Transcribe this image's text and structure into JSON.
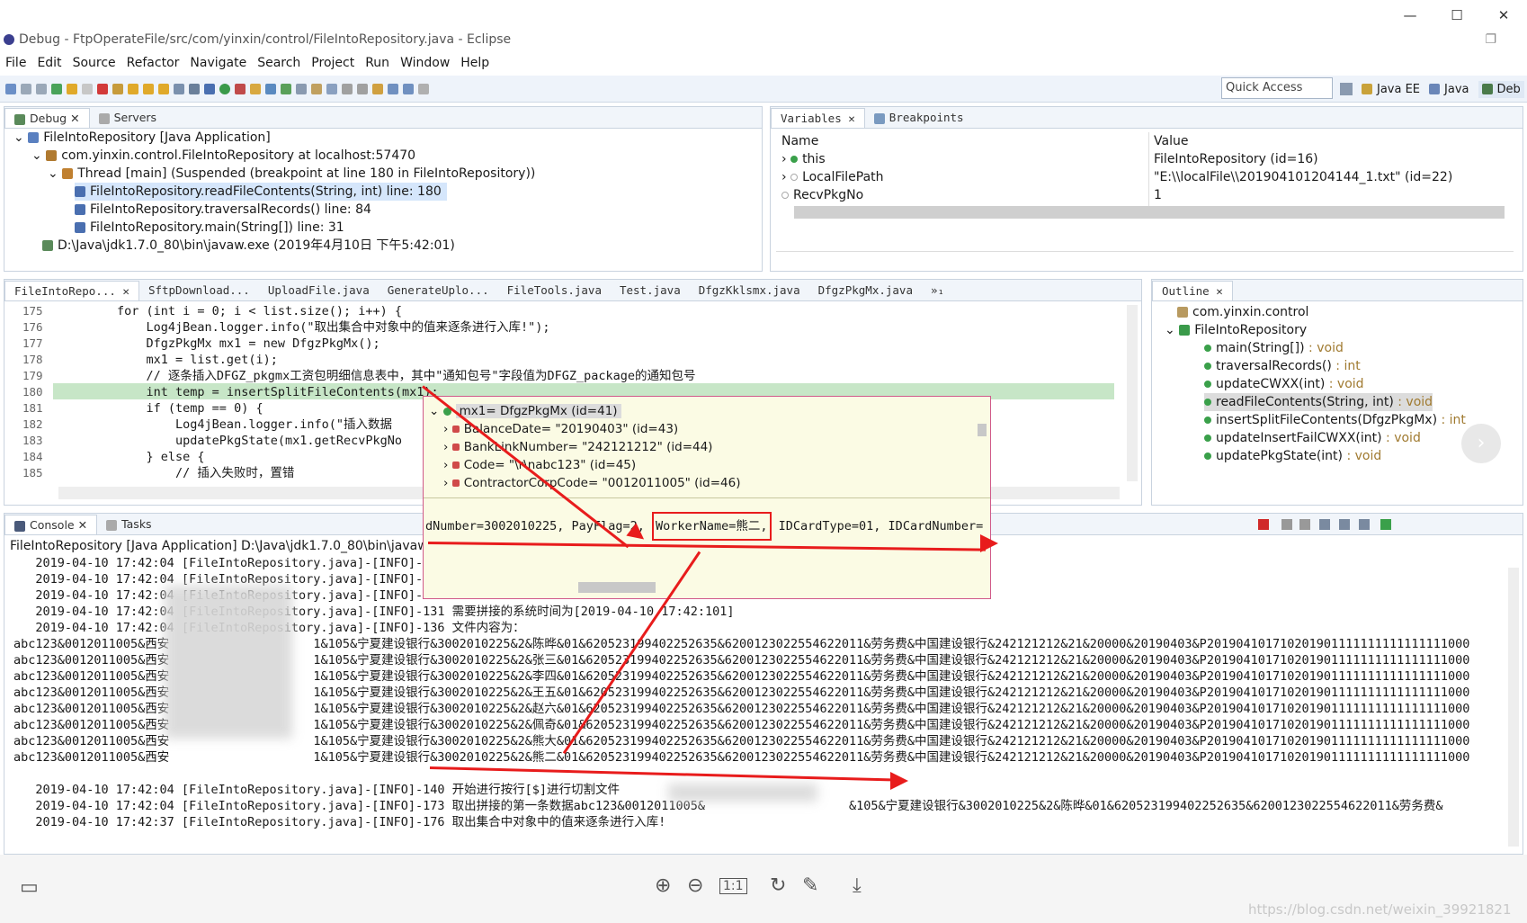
{
  "window": {
    "title": "Debug - FtpOperateFile/src/com/yinxin/control/FileIntoRepository.java - Eclipse",
    "controls": [
      "—",
      "☐",
      "✕"
    ]
  },
  "menu": [
    "File",
    "Edit",
    "Source",
    "Refactor",
    "Navigate",
    "Search",
    "Project",
    "Run",
    "Window",
    "Help"
  ],
  "toolbar": {
    "quick_access": "Quick Access",
    "perspectives": [
      "Java EE",
      "Java",
      "Deb"
    ]
  },
  "debug": {
    "tabs": [
      "Debug",
      "Servers"
    ],
    "tree": [
      "FileIntoRepository [Java Application]",
      "com.yinxin.control.FileIntoRepository at localhost:57470",
      "Thread [main] (Suspended (breakpoint at line 180 in FileIntoRepository))",
      "FileIntoRepository.readFileContents(String, int) line: 180",
      "FileIntoRepository.traversalRecords() line: 84",
      "FileIntoRepository.main(String[]) line: 31",
      "D:\\Java\\jdk1.7.0_80\\bin\\javaw.exe (2019年4月10日 下午5:42:01)"
    ]
  },
  "variables": {
    "tabs": [
      "Variables",
      "Breakpoints"
    ],
    "col_name": "Name",
    "col_value": "Value",
    "rows": [
      {
        "name": "this",
        "value": "FileIntoRepository  (id=16)"
      },
      {
        "name": "LocalFilePath",
        "value": "\"E:\\\\localFile\\\\201904101204144_1.txt\" (id=22)"
      },
      {
        "name": "RecvPkgNo",
        "value": "1"
      }
    ]
  },
  "editor": {
    "tabs": [
      "FileIntoRepo...",
      "SftpDownload...",
      "UploadFile.java",
      "GenerateUplo...",
      "FileTools.java",
      "Test.java",
      "DfgzKklsmx.java",
      "DfgzPkgMx.java",
      "»₁"
    ],
    "lines": [
      "175",
      "176",
      "177",
      "178",
      "179",
      "180",
      "181",
      "182",
      "183",
      "184",
      "185"
    ],
    "code": [
      "        for (int i = 0; i < list.size(); i++) {",
      "            Log4jBean.logger.info(\"取出集合中对象中的值来逐条进行入库!\");",
      "            DfgzPkgMx mx1 = new DfgzPkgMx();",
      "            mx1 = list.get(i);",
      "            // 逐条插入DFGZ_pkgmx工资包明细信息表中，其中\"通知包号\"字段值为DFGZ_package的通知包号",
      "            int temp = insertSplitFileContents(mx1);",
      "            if (temp == 0) {",
      "                Log4jBean.logger.info(\"插入数据",
      "                updatePkgState(mx1.getRecvPkgNo",
      "            } else {",
      "                // 插入失败时，置错"
    ]
  },
  "hover": {
    "items": [
      "mx1= DfgzPkgMx  (id=41)",
      "BalanceDate= \"20190403\" (id=43)",
      "BankLinkNumber= \"242121212\" (id=44)",
      "Code= \"\\r\\nabc123\" (id=45)",
      "ContractorCorpCode= \"0012011005\" (id=46)"
    ],
    "detail_pre": "dNumber=3002010225, PayFlag=2, ",
    "detail_box": "WorkerName=熊二,",
    "detail_post": " IDCardType=01, IDCardNumber="
  },
  "outline": {
    "tab": "Outline",
    "items": [
      {
        "name": "com.yinxin.control",
        "type": ""
      },
      {
        "name": "FileIntoRepository",
        "type": ""
      },
      {
        "name": "main(String[])",
        "type": " : void"
      },
      {
        "name": "traversalRecords()",
        "type": " : int"
      },
      {
        "name": "updateCWXX(int)",
        "type": " : void"
      },
      {
        "name": "readFileContents(String, int)",
        "type": " : void"
      },
      {
        "name": "insertSplitFileContents(DfgzPkgMx)",
        "type": " : int"
      },
      {
        "name": "updateInsertFailCWXX(int)",
        "type": " : void"
      },
      {
        "name": "updatePkgState(int)",
        "type": " : void"
      }
    ]
  },
  "console": {
    "tabs": [
      "Console",
      "Tasks"
    ],
    "header": "FileIntoRepository [Java Application] D:\\Java\\jdk1.7.0_80\\bin\\javaw.exe",
    "lines": [
      "   2019-04-10 17:42:04 [FileIntoRepository.java]-[INFO]-8",
      "   2019-04-10 17:42:04 [FileIntoRepository.java]-[INFO]-1",
      "   2019-04-10 17:42:04 [FileIntoRepository.java]-[INFO]-1",
      "   2019-04-10 17:42:04 [FileIntoRepository.java]-[INFO]-131 需要拼接的系统时间为[2019-04-10 17:42:101]",
      "   2019-04-10 17:42:04 [FileIntoRepository.java]-[INFO]-136 文件内容为：",
      "abc123&0012011005&西安",
      "abc123&0012011005&西安",
      "abc123&0012011005&西安",
      "abc123&0012011005&西安",
      "abc123&0012011005&西安",
      "abc123&0012011005&西安",
      "abc123&0012011005&西安",
      "abc123&0012011005&西安"
    ],
    "records": [
      "1&105&宁夏建设银行&3002010225&2&陈晔&01&620523199402252635&6200123022554622011&劳务费&中国建设银行&242121212&21&20000&20190403&P201904101710201901111111111111111000",
      "1&105&宁夏建设银行&3002010225&2&张三&01&620523199402252635&6200123022554622011&劳务费&中国建设银行&242121212&21&20000&20190403&P201904101710201901111111111111111000",
      "1&105&宁夏建设银行&3002010225&2&李四&01&620523199402252635&6200123022554622011&劳务费&中国建设银行&242121212&21&20000&20190403&P201904101710201901111111111111111000",
      "1&105&宁夏建设银行&3002010225&2&王五&01&620523199402252635&6200123022554622011&劳务费&中国建设银行&242121212&21&20000&20190403&P201904101710201901111111111111111000",
      "1&105&宁夏建设银行&3002010225&2&赵六&01&620523199402252635&6200123022554622011&劳务费&中国建设银行&242121212&21&20000&20190403&P201904101710201901111111111111111000",
      "1&105&宁夏建设银行&3002010225&2&佩奇&01&620523199402252635&6200123022554622011&劳务费&中国建设银行&242121212&21&20000&20190403&P201904101710201901111111111111111000",
      "1&105&宁夏建设银行&3002010225&2&熊大&01&620523199402252635&6200123022554622011&劳务费&中国建设银行&242121212&21&20000&20190403&P201904101710201901111111111111111000",
      "1&105&宁夏建设银行&3002010225&2&熊二&01&620523199402252635&6200123022554622011&劳务费&中国建设银行&242121212&21&20000&20190403&P201904101710201901111111111111111000"
    ],
    "tail": [
      "   2019-04-10 17:42:04 [FileIntoRepository.java]-[INFO]-140 开始进行按行[$]进行切割文件",
      "   2019-04-10 17:42:04 [FileIntoRepository.java]-[INFO]-173 取出拼接的第一条数据abc123&0012011005&",
      "   2019-04-10 17:42:37 [FileIntoRepository.java]-[INFO]-176 取出集合中对象中的值来逐条进行入库!"
    ],
    "tail_end": "&105&宁夏建设银行&3002010225&2&陈晔&01&620523199402252635&6200123022554622011&劳务费&"
  },
  "viewer": {
    "watermark": "https://blog.csdn.net/weixin_39921821"
  },
  "colors": {
    "accent": "#e81c1c",
    "selection": "#d5e6fb",
    "highlight": "#c7e6c7"
  }
}
